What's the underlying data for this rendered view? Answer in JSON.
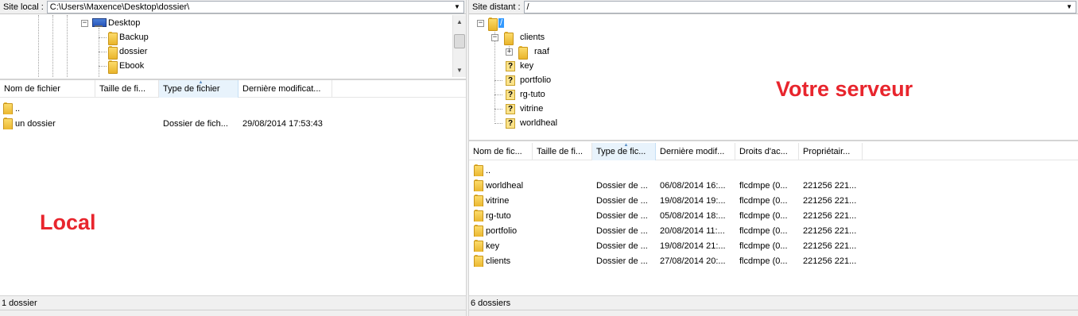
{
  "local": {
    "site_label": "Site local :",
    "path": "C:\\Users\\Maxence\\Desktop\\dossier\\",
    "tree": [
      {
        "label": "Desktop",
        "icon": "desktop-icon"
      },
      {
        "label": "Backup",
        "icon": "folder-icon"
      },
      {
        "label": "dossier",
        "icon": "folder-icon"
      },
      {
        "label": "Ebook",
        "icon": "folder-icon"
      }
    ],
    "columns": [
      "Nom de fichier",
      "Taille de fi...",
      "Type de fichier",
      "Dernière modificat..."
    ],
    "rows": [
      {
        "name": "..",
        "type": "",
        "modified": ""
      },
      {
        "name": "un dossier",
        "type": "Dossier de fich...",
        "modified": "29/08/2014 17:53:43"
      }
    ],
    "annotation": "Local",
    "status": "1 dossier"
  },
  "remote": {
    "site_label": "Site distant :",
    "path": "/",
    "tree": {
      "root": "/",
      "items": [
        {
          "label": "clients",
          "icon": "folder-icon"
        },
        {
          "label": "raaf",
          "icon": "folder-icon"
        },
        {
          "label": "key",
          "icon": "unknown-icon"
        },
        {
          "label": "portfolio",
          "icon": "unknown-icon"
        },
        {
          "label": "rg-tuto",
          "icon": "unknown-icon"
        },
        {
          "label": "vitrine",
          "icon": "unknown-icon"
        },
        {
          "label": "worldheal",
          "icon": "unknown-icon"
        }
      ]
    },
    "columns": [
      "Nom de fic...",
      "Taille de fi...",
      "Type de fic...",
      "Dernière modif...",
      "Droits d'ac...",
      "Propriétair..."
    ],
    "rows": [
      {
        "name": "..",
        "type": "",
        "modified": "",
        "perms": "",
        "owner": ""
      },
      {
        "name": "worldheal",
        "type": "Dossier de ...",
        "modified": "06/08/2014 16:...",
        "perms": "flcdmpe (0...",
        "owner": "221256 221..."
      },
      {
        "name": "vitrine",
        "type": "Dossier de ...",
        "modified": "19/08/2014 19:...",
        "perms": "flcdmpe (0...",
        "owner": "221256 221..."
      },
      {
        "name": "rg-tuto",
        "type": "Dossier de ...",
        "modified": "05/08/2014 18:...",
        "perms": "flcdmpe (0...",
        "owner": "221256 221..."
      },
      {
        "name": "portfolio",
        "type": "Dossier de ...",
        "modified": "20/08/2014 11:...",
        "perms": "flcdmpe (0...",
        "owner": "221256 221..."
      },
      {
        "name": "key",
        "type": "Dossier de ...",
        "modified": "19/08/2014 21:...",
        "perms": "flcdmpe (0...",
        "owner": "221256 221..."
      },
      {
        "name": "clients",
        "type": "Dossier de ...",
        "modified": "27/08/2014 20:...",
        "perms": "flcdmpe (0...",
        "owner": "221256 221..."
      }
    ],
    "annotation": "Votre serveur",
    "status": "6 dossiers"
  },
  "colors": {
    "annotation": "#e8252d",
    "selection": "#3399ff",
    "sorted_header": "#e8f3fc"
  }
}
